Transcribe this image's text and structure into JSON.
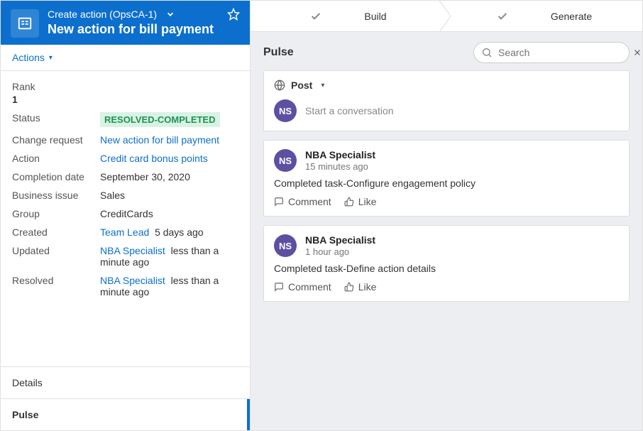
{
  "header": {
    "breadcrumb": "Create action  (OpsCA-1)",
    "title": "New action for bill payment"
  },
  "actions_label": "Actions",
  "rank": {
    "label": "Rank",
    "value": "1"
  },
  "status": {
    "label": "Status",
    "value": "RESOLVED-COMPLETED"
  },
  "details": {
    "change_request": {
      "label": "Change request",
      "value": "New action for bill payment"
    },
    "action": {
      "label": "Action",
      "value": "Credit card bonus points"
    },
    "completion_date": {
      "label": "Completion date",
      "value": "September 30, 2020"
    },
    "business_issue": {
      "label": "Business issue",
      "value": "Sales"
    },
    "group": {
      "label": "Group",
      "value": "CreditCards"
    },
    "created": {
      "label": "Created",
      "user": "Team Lead",
      "time": "5 days ago"
    },
    "updated": {
      "label": "Updated",
      "user": "NBA Specialist",
      "time": "less than a minute ago"
    },
    "resolved": {
      "label": "Resolved",
      "user": "NBA Specialist",
      "time": "less than a minute ago"
    }
  },
  "tabs": {
    "details": "Details",
    "pulse": "Pulse"
  },
  "steps": {
    "build": "Build",
    "generate": "Generate"
  },
  "pulse": {
    "title": "Pulse",
    "search_placeholder": "Search",
    "post_label": "Post",
    "avatar_initials": "NS",
    "start_placeholder": "Start a conversation",
    "comment_label": "Comment",
    "like_label": "Like",
    "items": [
      {
        "author": "NBA Specialist",
        "time": "15 minutes ago",
        "body": "Completed task-Configure engagement policy"
      },
      {
        "author": "NBA Specialist",
        "time": "1 hour ago",
        "body": "Completed task-Define action details"
      }
    ]
  }
}
